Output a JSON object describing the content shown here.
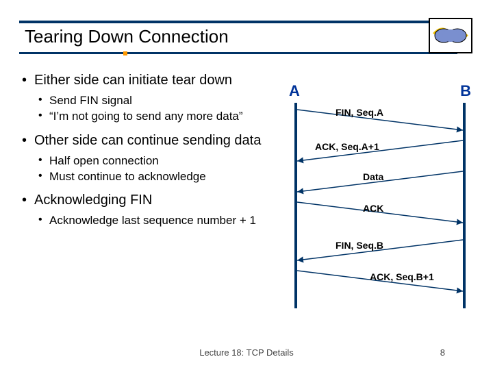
{
  "title": "Tearing Down Connection",
  "bullets": {
    "b1a": "Either side can initiate tear down",
    "b1a_s1": "Send FIN signal",
    "b1a_s2": "“I’m not going to send any more data”",
    "b1b": "Other side can continue sending data",
    "b1b_s1": "Half open connection",
    "b1b_s2": "Must continue to acknowledge",
    "b1c": "Acknowledging FIN",
    "b1c_s1": "Acknowledge last sequence number + 1"
  },
  "diagram": {
    "endpointA": "A",
    "endpointB": "B",
    "msgs": {
      "finA": "FIN, Seq.A",
      "ackA1": "ACK, Seq.A+1",
      "data": "Data",
      "ack": "ACK",
      "finB": "FIN, Seq.B",
      "ackB1": "ACK, Seq.B+1"
    }
  },
  "footer": "Lecture 18: TCP Details",
  "pagenum": "8"
}
